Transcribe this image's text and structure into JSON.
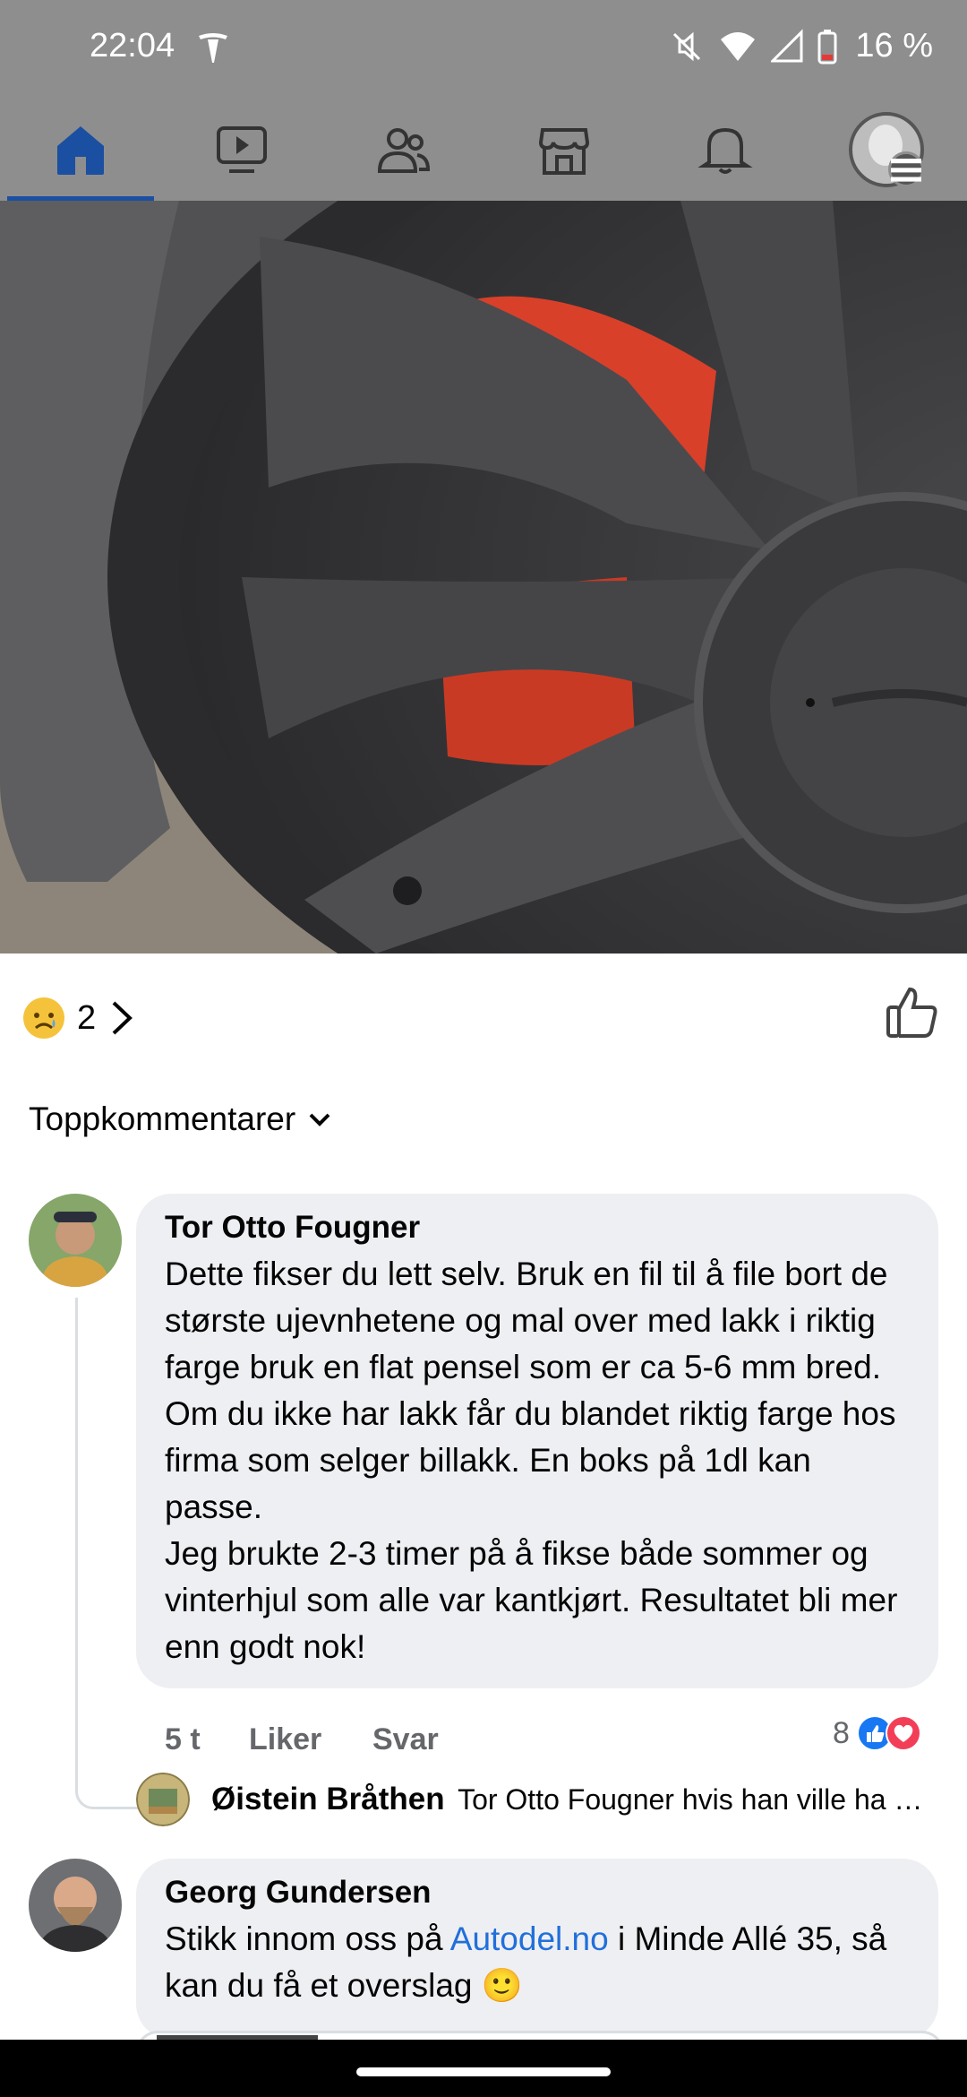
{
  "status_bar": {
    "time": "22:04",
    "battery": "16 %",
    "icons": [
      "tesla-icon",
      "mute-icon",
      "wifi-icon",
      "signal-icon",
      "battery-icon"
    ]
  },
  "nav": {
    "items": [
      "home-icon",
      "video-icon",
      "groups-icon",
      "marketplace-icon",
      "notifications-icon",
      "profile-menu"
    ],
    "active": "home-icon"
  },
  "reactions": {
    "emoji": "sad",
    "count": "2"
  },
  "comments_header": {
    "label": "Toppkommentarer"
  },
  "comments": [
    {
      "author": "Tor Otto Fougner",
      "text": "Dette fikser du lett selv. Bruk en fil til å file bort de største ujevnhetene og mal over med lakk i riktig farge bruk en flat pensel som er ca 5-6 mm bred. Om du ikke har lakk får du blandet riktig farge hos firma som selger billakk. En boks på 1dl kan passe.\nJeg brukte 2-3 timer på å fikse både sommer og vinterhjul som alle var kantkjørt. Resultatet bli mer enn godt nok!",
      "time": "5 t",
      "like_label": "Liker",
      "reply_label": "Svar",
      "reaction_count": "8",
      "reply": {
        "author": "Øistein Bråthen",
        "preview": "Tor Otto Fougner hvis han ville ha …"
      }
    },
    {
      "author": "Georg Gundersen",
      "text_before": "Stikk innom oss på ",
      "link": "Autodel.no",
      "text_after": " i Minde Allé 35, så kan du få et overslag 🙂"
    }
  ]
}
